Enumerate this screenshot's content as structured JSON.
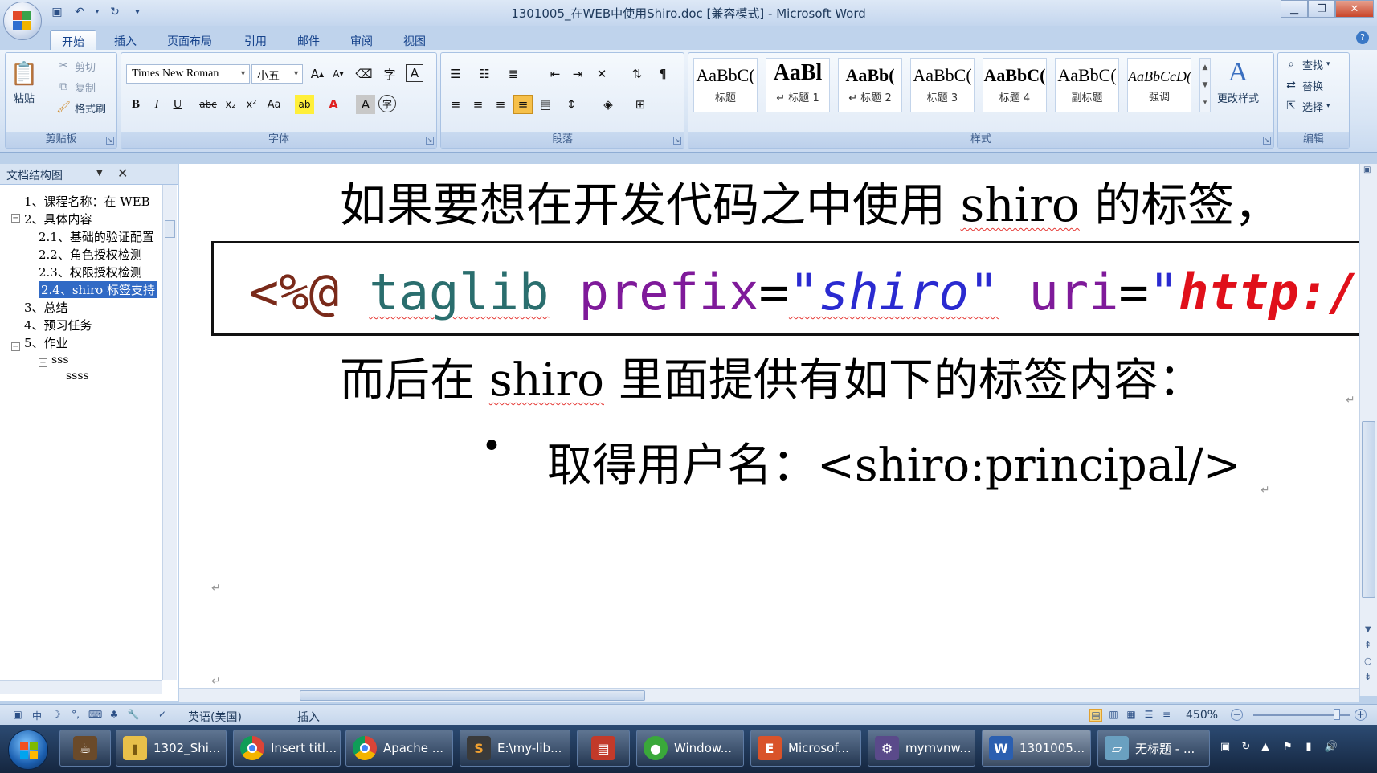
{
  "window": {
    "title": "1301005_在WEB中使用Shiro.doc [兼容模式] - Microsoft Word"
  },
  "quick_access": {
    "icons": [
      "save-icon",
      "undo-icon",
      "redo-icon",
      "customize-icon"
    ]
  },
  "ribbon_tabs": [
    "开始",
    "插入",
    "页面布局",
    "引用",
    "邮件",
    "审阅",
    "视图"
  ],
  "clipboard": {
    "paste_label": "粘贴",
    "cut_label": "剪切",
    "copy_label": "复制",
    "format_painter_label": "格式刷",
    "group_label": "剪贴板"
  },
  "font": {
    "name": "Times New Roman",
    "size": "小五",
    "group_label": "字体"
  },
  "paragraph": {
    "group_label": "段落"
  },
  "styles": {
    "items": [
      {
        "sample": "AaBbC(",
        "name": "标题"
      },
      {
        "sample": "AaBl",
        "name": "↵ 标题 1"
      },
      {
        "sample": "AaBb(",
        "name": "↵ 标题 2"
      },
      {
        "sample": "AaBbC(",
        "name": "标题 3"
      },
      {
        "sample": "AaBbC(",
        "name": "标题 4"
      },
      {
        "sample": "AaBbC(",
        "name": "副标题"
      },
      {
        "sample": "AaBbCcD(",
        "name": "强调"
      }
    ],
    "change_label": "更改样式",
    "group_label": "样式"
  },
  "editing": {
    "find_label": "查找",
    "replace_label": "替换",
    "select_label": "选择",
    "group_label": "编辑"
  },
  "nav_pane": {
    "title": "文档结构图",
    "items": [
      {
        "label": "1、课程名称：在 WEB",
        "level": 0
      },
      {
        "label": "2、具体内容",
        "level": 0
      },
      {
        "label": "2.1、基础的验证配置",
        "level": 1
      },
      {
        "label": "2.2、角色授权检测",
        "level": 1
      },
      {
        "label": "2.3、权限授权检测",
        "level": 1
      },
      {
        "label": "2.4、shiro 标签支持",
        "level": 1
      },
      {
        "label": "3、总结",
        "level": 0
      },
      {
        "label": "4、预习任务",
        "level": 0
      },
      {
        "label": "5、作业",
        "level": 0
      },
      {
        "label": "sss",
        "level": 1
      },
      {
        "label": "ssss",
        "level": 2
      }
    ]
  },
  "document": {
    "line1_prefix": "如果要想在开发代码之中使用 ",
    "line1_word": "shiro",
    "line1_suffix": " 的标签，",
    "code": {
      "open": "<%@",
      "keyword": "taglib",
      "attr1": "prefix",
      "eq": "=",
      "val1": "\"shiro\"",
      "attr2": "uri",
      "val2_quote": "\"",
      "val2": "http:/"
    },
    "line2_prefix": "而后在 ",
    "line2_word": "shiro",
    "line2_suffix": " 里面提供有如下的标签内容：",
    "bullet": "•",
    "bullet_text": "取得用户名：<shiro:principal/>",
    "para_mark": "↵"
  },
  "status_bar": {
    "language": "英语(美国)",
    "mode": "插入",
    "zoom": "450%"
  },
  "taskbar": {
    "tasks": [
      {
        "label": "1302_Shi...",
        "color": "#e8c04a",
        "glyph": "▮"
      },
      {
        "label": "Insert titl...",
        "color": "#d64030",
        "glyph": "●"
      },
      {
        "label": "Apache ...",
        "color": "#d64030",
        "glyph": "●"
      },
      {
        "label": "E:\\my-lib...",
        "color": "#3a3a3a",
        "glyph": "S"
      },
      {
        "label": "",
        "color": "#c23a2a",
        "glyph": "▤"
      },
      {
        "label": "Window...",
        "color": "#3aa83a",
        "glyph": "●"
      },
      {
        "label": "Microsof...",
        "color": "#d9532a",
        "glyph": "E"
      },
      {
        "label": "mymvnw...",
        "color": "#5a4a8a",
        "glyph": "⚙"
      },
      {
        "label": "1301005...",
        "color": "#2b5fb0",
        "glyph": "W"
      },
      {
        "label": "无标题 - ...",
        "color": "#6aa0c0",
        "glyph": "▱"
      }
    ]
  }
}
